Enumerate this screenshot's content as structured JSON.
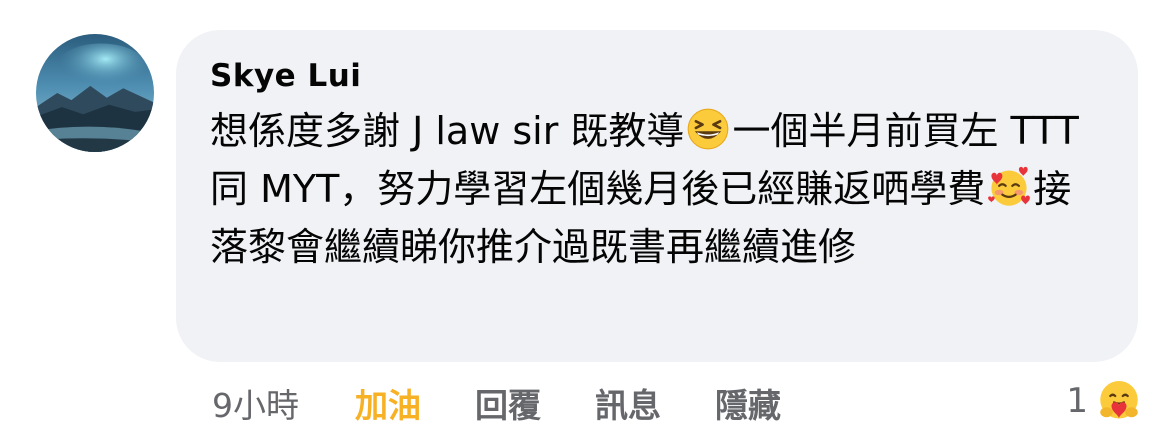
{
  "comment": {
    "author": "Skye Lui",
    "text_segments": [
      "想係度多謝 J law sir 既教導",
      "一個半月前買左 TTT 同 MYT，努力學習左個幾月後已經賺返哂學費",
      "接落黎會繼續睇你推介過既書再繼續進修"
    ],
    "emojis": [
      "grinning-squinting-face-icon",
      "smiling-face-with-hearts-icon"
    ]
  },
  "actions": {
    "timestamp": "9小時",
    "like_label": "加油",
    "reply_label": "回覆",
    "message_label": "訊息",
    "hide_label": "隱藏",
    "like_color": "#f7b125"
  },
  "reactions": {
    "count": "1",
    "icon": "care-reaction-icon"
  },
  "colors": {
    "bubble_background": "#f0f2f5",
    "text": "#050505",
    "secondary_text": "#65676b"
  }
}
